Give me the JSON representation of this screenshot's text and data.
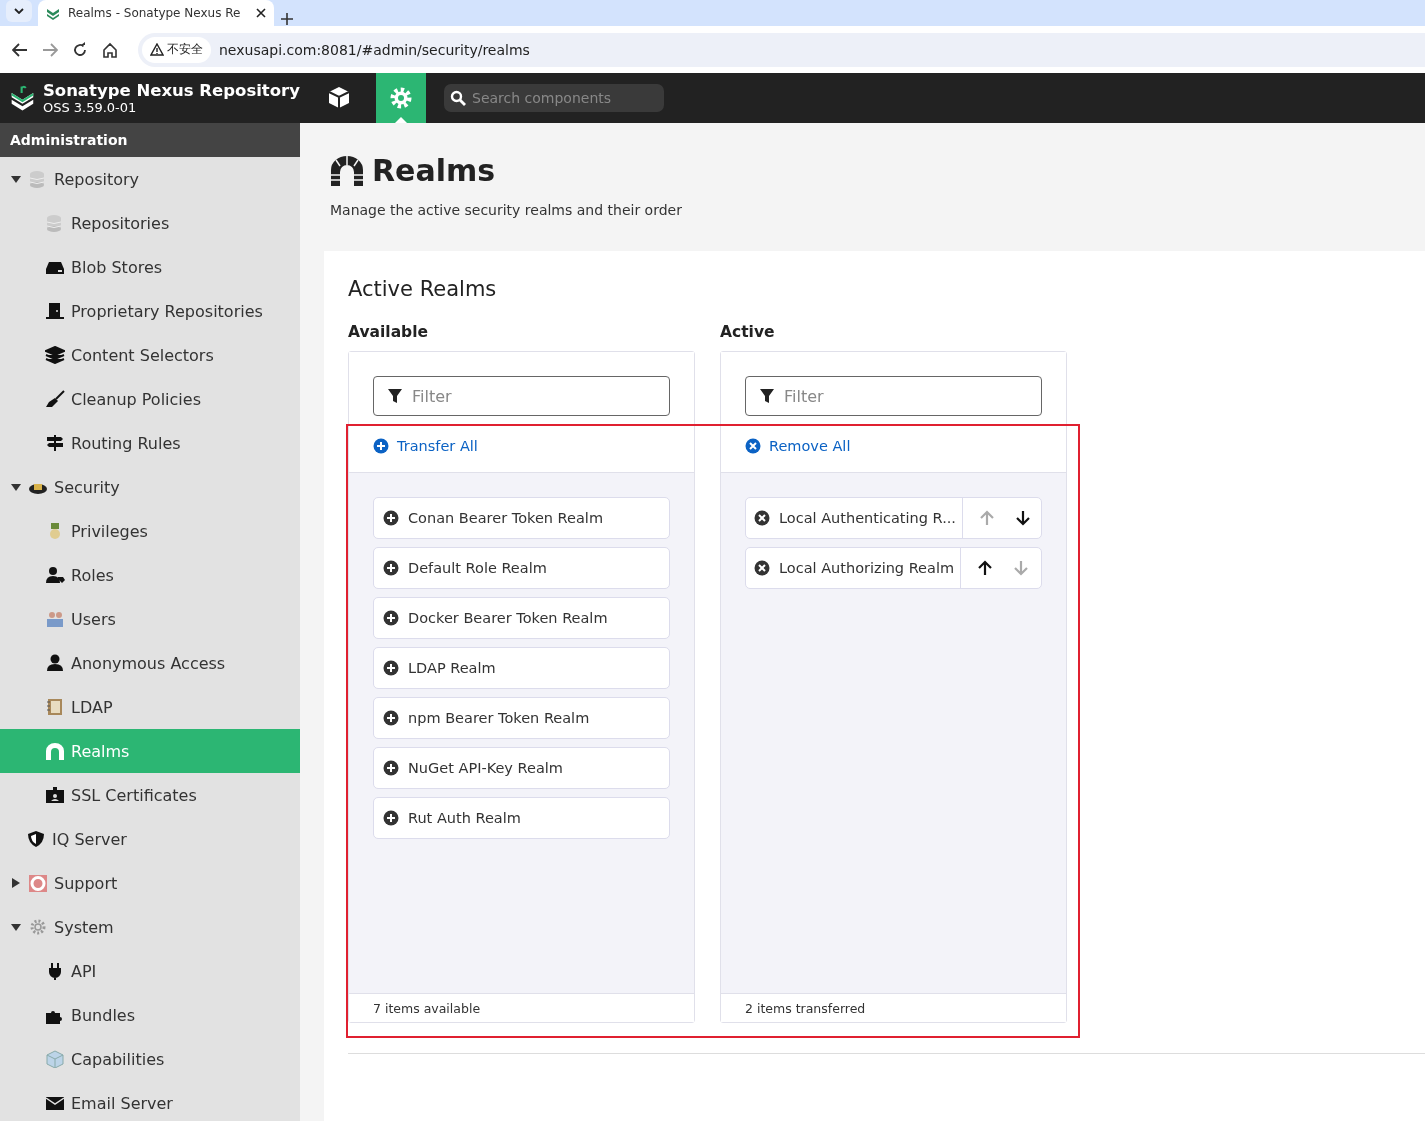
{
  "browser": {
    "tab_title": "Realms - Sonatype Nexus Re",
    "security_label": "不安全",
    "url": "nexusapi.com:8081/#admin/security/realms"
  },
  "header": {
    "product": "Sonatype Nexus Repository",
    "version": "OSS 3.59.0-01",
    "search": {
      "placeholder": "Search components"
    },
    "modes": [
      {
        "kind": "browse",
        "selected": false
      },
      {
        "kind": "admin",
        "selected": true
      }
    ]
  },
  "sidebar": {
    "title": "Administration",
    "items": [
      {
        "label": "Repository",
        "expanded": true,
        "selected": false,
        "children": [
          {
            "label": "Repositories",
            "selected": false
          },
          {
            "label": "Blob Stores",
            "selected": false
          },
          {
            "label": "Proprietary Repositories",
            "selected": false
          },
          {
            "label": "Content Selectors",
            "selected": false
          },
          {
            "label": "Cleanup Policies",
            "selected": false
          },
          {
            "label": "Routing Rules",
            "selected": false
          }
        ]
      },
      {
        "label": "Security",
        "expanded": true,
        "selected": false,
        "children": [
          {
            "label": "Privileges",
            "selected": false
          },
          {
            "label": "Roles",
            "selected": false
          },
          {
            "label": "Users",
            "selected": false
          },
          {
            "label": "Anonymous Access",
            "selected": false
          },
          {
            "label": "LDAP",
            "selected": false
          },
          {
            "label": "Realms",
            "selected": true
          },
          {
            "label": "SSL Certificates",
            "selected": false
          }
        ]
      },
      {
        "label": "IQ Server",
        "selected": false
      },
      {
        "label": "Support",
        "expanded": false,
        "selected": false
      },
      {
        "label": "System",
        "expanded": true,
        "selected": false,
        "children": [
          {
            "label": "API",
            "selected": false
          },
          {
            "label": "Bundles",
            "selected": false
          },
          {
            "label": "Capabilities",
            "selected": false
          },
          {
            "label": "Email Server",
            "selected": false
          }
        ]
      }
    ]
  },
  "page": {
    "title": "Realms",
    "description": "Manage the active security realms and their order",
    "section_title": "Active Realms",
    "available": {
      "heading": "Available",
      "filter": {
        "placeholder": "Filter"
      },
      "action": "Transfer All",
      "items": [
        "Conan Bearer Token Realm",
        "Default Role Realm",
        "Docker Bearer Token Realm",
        "LDAP Realm",
        "npm Bearer Token Realm",
        "NuGet API-Key Realm",
        "Rut Auth Realm"
      ],
      "footer": "7 items available"
    },
    "active": {
      "heading": "Active",
      "filter": {
        "placeholder": "Filter"
      },
      "action": "Remove All",
      "items": [
        {
          "label": "Local Authenticating R...",
          "up_disabled": true,
          "down_disabled": false
        },
        {
          "label": "Local Authorizing Realm",
          "up_disabled": false,
          "down_disabled": true
        }
      ],
      "footer": "2 items transferred"
    }
  }
}
